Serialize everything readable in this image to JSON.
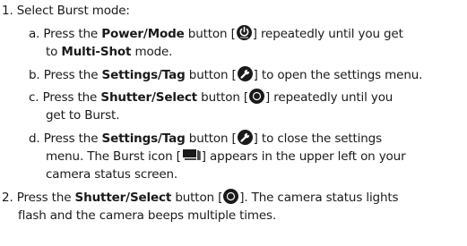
{
  "steps": [
    {
      "num": "1.",
      "text": "Select Burst mode:",
      "substeps": [
        {
          "letter": "a.",
          "pre": "Press the",
          "bold": "Power/Mode",
          "post": "button [",
          "icon": "power-mode-icon",
          "after": "] repeatedly until you get",
          "cont": [
            "to"
          ],
          "cont_bold": "Multi-Shot",
          "cont_post": "mode."
        },
        {
          "letter": "b.",
          "pre": "Press the",
          "bold": "Settings/Tag",
          "post": "button [",
          "icon": "wrench-icon",
          "after": "] to open the settings menu."
        },
        {
          "letter": "c.",
          "pre": "Press the",
          "bold": "Shutter/Select",
          "post": "button [",
          "icon": "shutter-icon",
          "after": "] repeatedly until you",
          "cont": [
            "get to Burst."
          ]
        },
        {
          "letter": "d.",
          "pre": "Press the",
          "bold": "Settings/Tag",
          "post": "button [",
          "icon": "wrench-icon",
          "after": "] to close the settings",
          "cont": [
            "menu. The Burst icon [",
            "] appears in the upper left on your",
            "camera status screen."
          ]
        }
      ]
    },
    {
      "num": "2.",
      "pre": "Press the",
      "bold": "Shutter/Select",
      "post": "button [",
      "icon": "shutter-icon",
      "after": "]. The camera status lights",
      "cont": [
        "flash and the camera beeps multiple times."
      ]
    }
  ],
  "icons": {
    "power_sublabel": "mode"
  }
}
